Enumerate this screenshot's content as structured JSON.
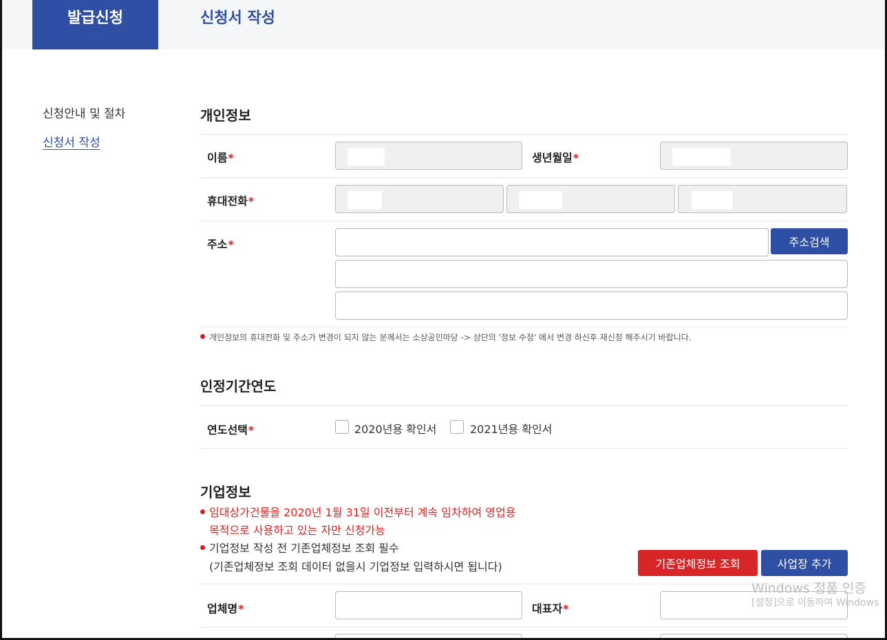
{
  "header": {
    "tab_label": "발급신청",
    "page_title": "신청서 작성"
  },
  "sidebar": {
    "items": [
      {
        "label": "신청안내 및 절차"
      },
      {
        "label": "신청서 작성"
      }
    ]
  },
  "personal": {
    "title": "개인정보",
    "name_label": "이름",
    "birth_label": "생년월일",
    "phone_label": "휴대전화",
    "address_label": "주소",
    "address_search_button": "주소검색",
    "required_mark": "*",
    "notice": "개인정보의 휴대전화 및 주소가 변경이 되지 않는 분께서는 소상공인마당 -> 상단의 '정보 수정' 에서 변경 하신후 재신청 해주시기 바랍니다."
  },
  "period": {
    "title": "인정기간연도",
    "year_label": "연도선택",
    "options": [
      "2020년용 확인서",
      "2021년용 확인서"
    ]
  },
  "company": {
    "title": "기업정보",
    "notice_red_line1": "임대상가건물을 2020년 1월 31일 이전부터 계속 임차하여 영업용",
    "notice_red_line2": "목적으로 사용하고 있는 자만 신청가능",
    "notice_line1": "기업정보 작성 전 기존업체정보 조회 필수",
    "notice_line2": "(기존업체정보 조회 데이터 없을시 기업정보 입력하시면 됩니다)",
    "lookup_button": "기존업체정보 조회",
    "add_button": "사업장 추가",
    "company_name_label": "업체명",
    "ceo_label": "대표자"
  },
  "watermark": {
    "line1": "Windows 정품 인증",
    "line2": "[설정]으로 이동하여 Windows"
  },
  "colors": {
    "accent": "#2e4fa3",
    "danger": "#d72528"
  }
}
